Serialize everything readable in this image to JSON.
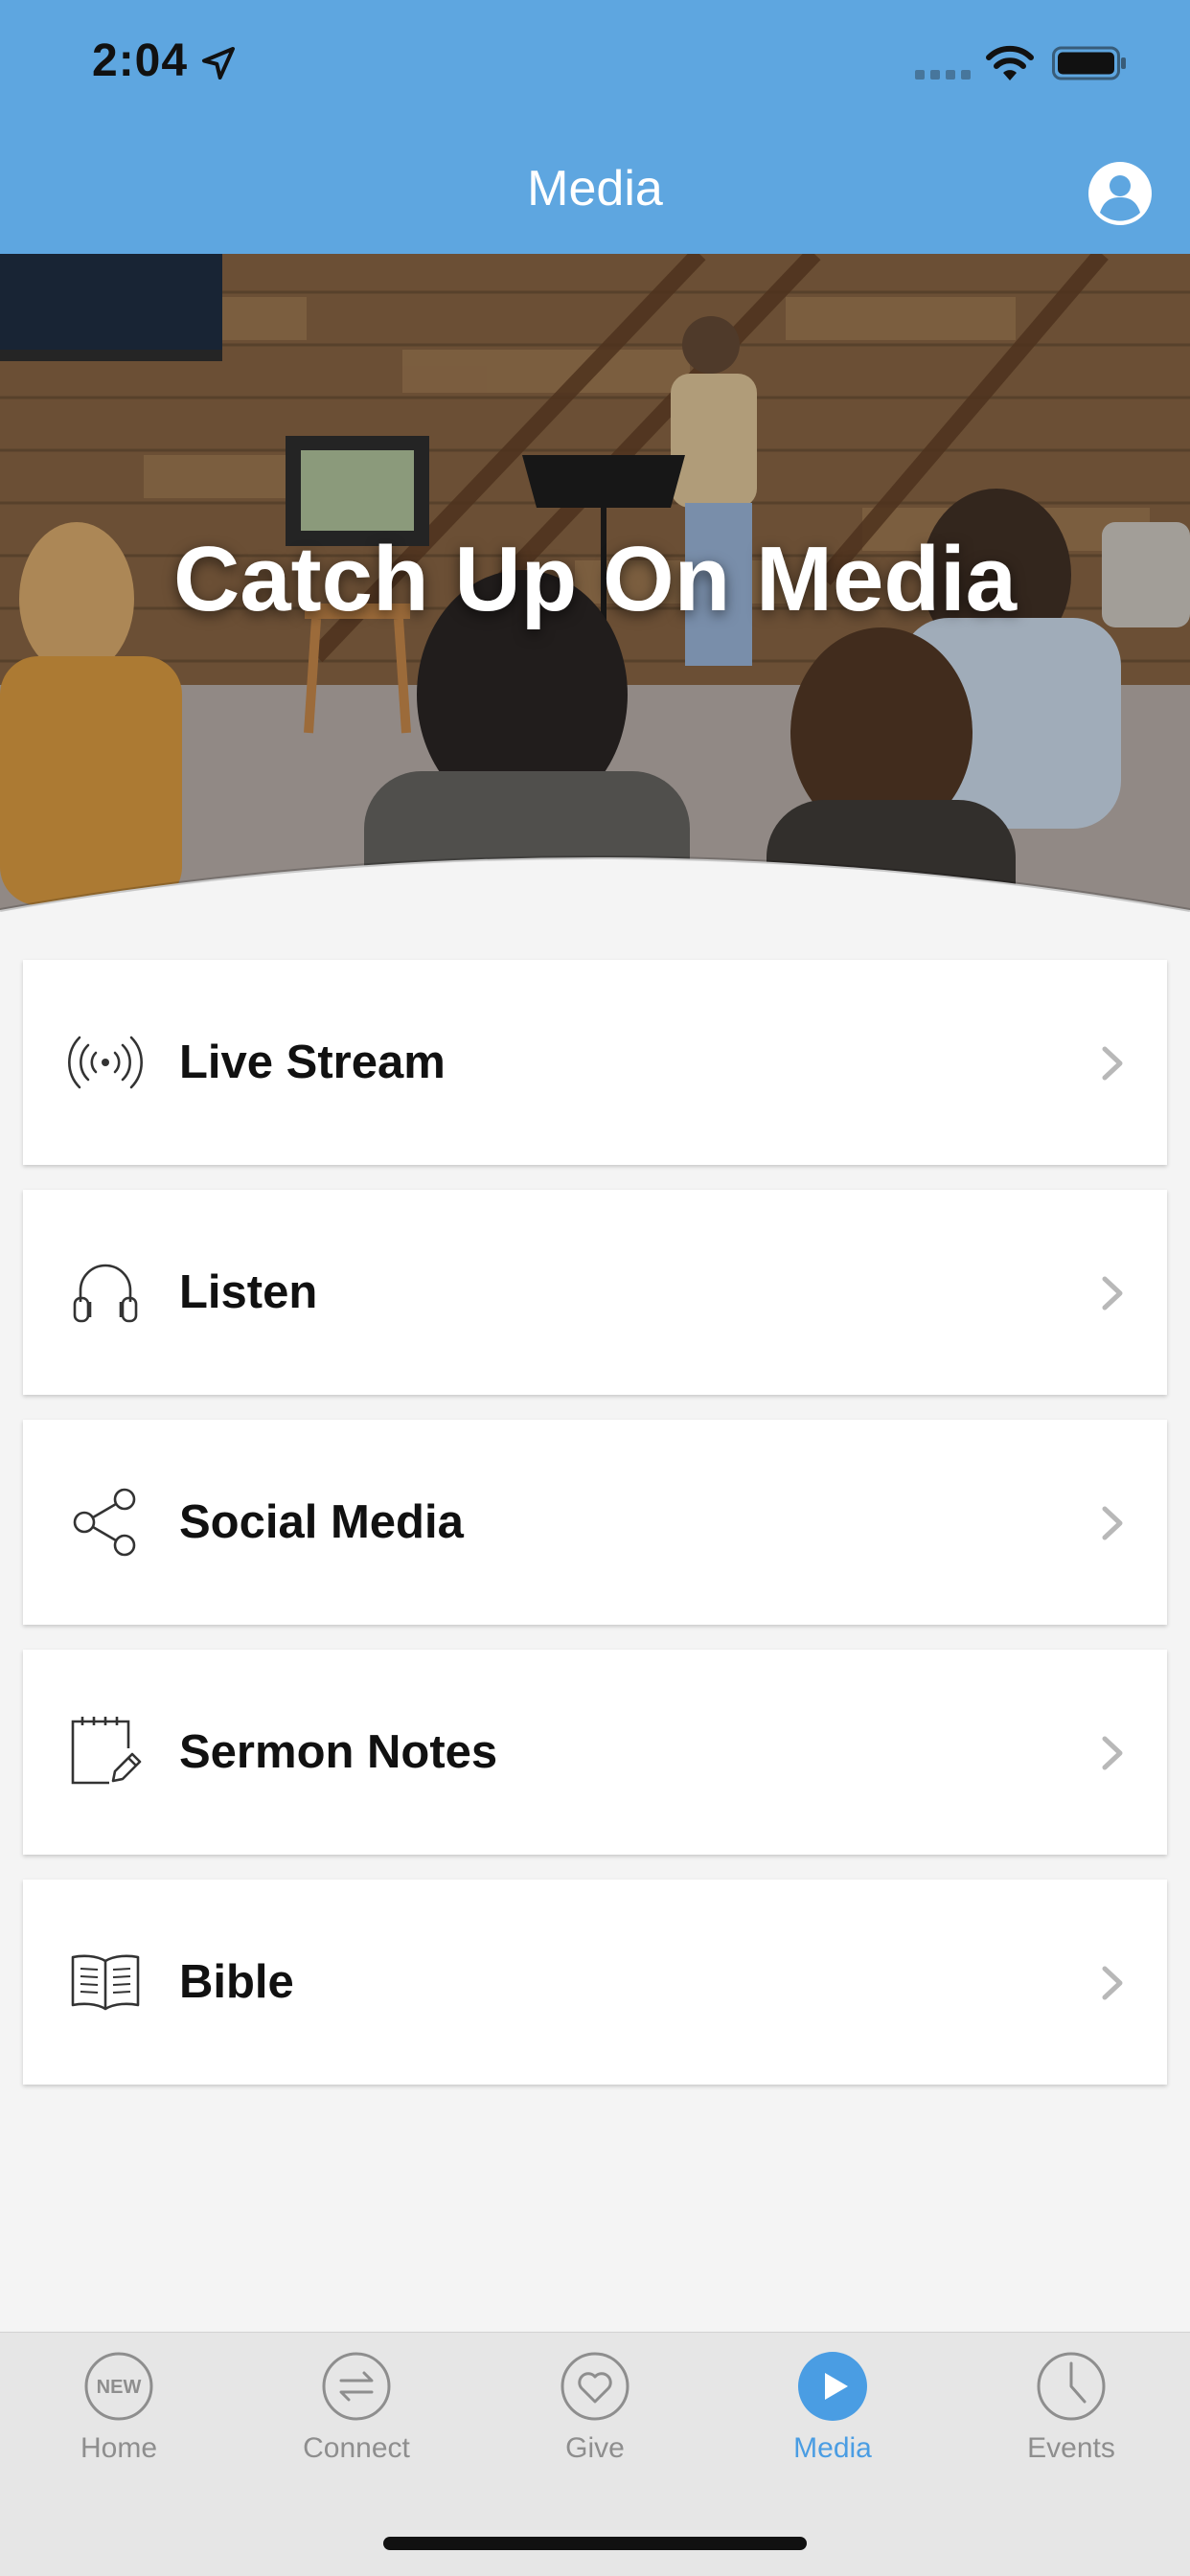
{
  "status_bar": {
    "time": "2:04"
  },
  "nav": {
    "title": "Media",
    "profile_icon": "person-circle-icon"
  },
  "hero": {
    "title": "Catch Up On Media"
  },
  "menu": [
    {
      "label": "Live Stream",
      "icon": "broadcast-icon"
    },
    {
      "label": "Listen",
      "icon": "headphones-icon"
    },
    {
      "label": "Social Media",
      "icon": "share-icon"
    },
    {
      "label": "Sermon Notes",
      "icon": "notepad-pencil-icon"
    },
    {
      "label": "Bible",
      "icon": "open-book-icon"
    }
  ],
  "tabs": [
    {
      "label": "Home",
      "icon": "new-badge-icon",
      "badge": "NEW",
      "active": false
    },
    {
      "label": "Connect",
      "icon": "swap-arrows-icon",
      "active": false
    },
    {
      "label": "Give",
      "icon": "heart-icon",
      "active": false
    },
    {
      "label": "Media",
      "icon": "play-icon",
      "active": true
    },
    {
      "label": "Events",
      "icon": "clock-icon",
      "active": false
    }
  ],
  "colors": {
    "primary": "#5ea6e0",
    "active_tab": "#4a9de3",
    "inactive_tab": "#8e8e8e",
    "background": "#f4f4f4",
    "tabbar_bg": "#e6e6e6"
  }
}
